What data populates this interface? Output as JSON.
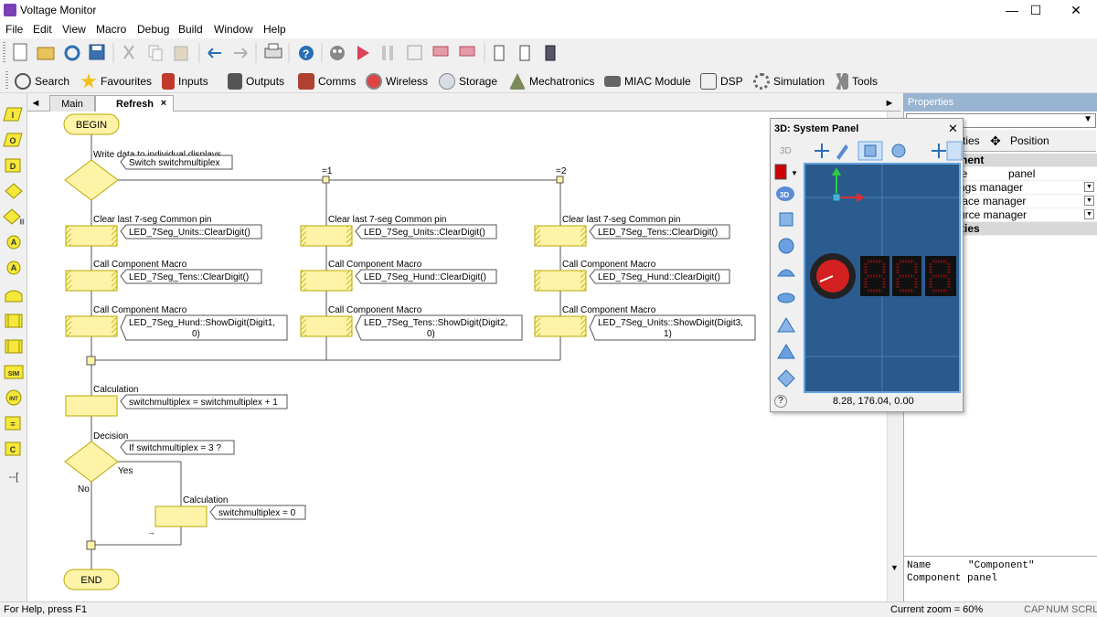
{
  "window": {
    "title": "Voltage Monitor",
    "min": "—",
    "max": "☐",
    "close": "✕"
  },
  "menu": [
    "File",
    "Edit",
    "View",
    "Macro",
    "Debug",
    "Build",
    "Window",
    "Help"
  ],
  "categories": [
    {
      "label": "Search",
      "icon": "search-icon"
    },
    {
      "label": "Favourites",
      "icon": "star-icon"
    },
    {
      "label": "Inputs",
      "icon": "inputs-icon"
    },
    {
      "label": "Outputs",
      "icon": "outputs-icon"
    },
    {
      "label": "Comms",
      "icon": "comms-icon"
    },
    {
      "label": "Wireless",
      "icon": "wireless-icon"
    },
    {
      "label": "Storage",
      "icon": "storage-icon"
    },
    {
      "label": "Mechatronics",
      "icon": "mechatronics-icon"
    },
    {
      "label": "MIAC Module",
      "icon": "miac-icon"
    },
    {
      "label": "DSP",
      "icon": "dsp-icon"
    },
    {
      "label": "Simulation",
      "icon": "gear-icon"
    },
    {
      "label": "Tools",
      "icon": "tools-icon"
    }
  ],
  "palette": [
    "I",
    "O",
    "D",
    "",
    "",
    "A",
    "A",
    "",
    "",
    "",
    "SIM",
    "INT",
    "=",
    "C",
    "--["
  ],
  "tabs": {
    "left_arrow": "◄",
    "right_arrow": "►",
    "main": "Main",
    "refresh": "Refresh",
    "close": "×"
  },
  "flow": {
    "begin": "BEGIN",
    "end": "END",
    "switch_title": "Write data to individual displays",
    "switch_label": "Switch switchmultiplex",
    "case1": "=1",
    "case2": "=2",
    "col0": {
      "t1": "Clear last 7-seg Common pin",
      "c1": "LED_7Seg_Units::ClearDigit()",
      "t2": "Call Component Macro",
      "c2": "LED_7Seg_Tens::ClearDigit()",
      "t3": "Call Component Macro",
      "c3a": "LED_7Seg_Hund::ShowDigit(Digit1,",
      "c3b": "0)"
    },
    "col1": {
      "t1": "Clear last 7-seg Common pin",
      "c1": "LED_7Seg_Units::ClearDigit()",
      "t2": "Call Component Macro",
      "c2": "LED_7Seg_Hund::ClearDigit()",
      "t3": "Call Component Macro",
      "c3a": "LED_7Seg_Tens::ShowDigit(Digit2,",
      "c3b": "0)"
    },
    "col2": {
      "t1": "Clear last 7-seg Common pin",
      "c1": "LED_7Seg_Tens::ClearDigit()",
      "t2": "Call Component Macro",
      "c2": "LED_7Seg_Hund::ClearDigit()",
      "t3": "Call Component Macro",
      "c3a": "LED_7Seg_Units::ShowDigit(Digit3,",
      "c3b": "1)"
    },
    "calc1_title": "Calculation",
    "calc1": "switchmultiplex = switchmultiplex + 1",
    "decision_title": "Decision",
    "decision": "If  switchmultiplex = 3 ?",
    "yes": "Yes",
    "no": "No",
    "calc2_title": "Calculation",
    "calc2": "switchmultiplex = 0",
    "arrow": "→"
  },
  "panel3d": {
    "title": "3D: System Panel",
    "close": "✕",
    "mode": "3D",
    "coords": "8.28, 176.04, 0.00",
    "help": "?"
  },
  "properties": {
    "title": "Properties",
    "tab_partial": "ties",
    "tab_position": "Position",
    "section1": "nent",
    "row1_name": "le",
    "row1_value": "panel",
    "row2": "ngs manager",
    "row3": "face manager",
    "row4": "urce manager",
    "section2": "ties",
    "desc_name_label": "Name",
    "desc_name_value": "\"Component\"",
    "desc_line2": "Component panel"
  },
  "status": {
    "help": "For Help, press F1",
    "zoom": "Current zoom = 60%",
    "cap": "CAP",
    "num": "NUM",
    "scrl": "SCRL"
  },
  "colors": {
    "flow_fill": "#fff3a8",
    "flow_stroke": "#b8a800",
    "viewport": "#2b5c8f",
    "led_red": "#cc0000"
  }
}
